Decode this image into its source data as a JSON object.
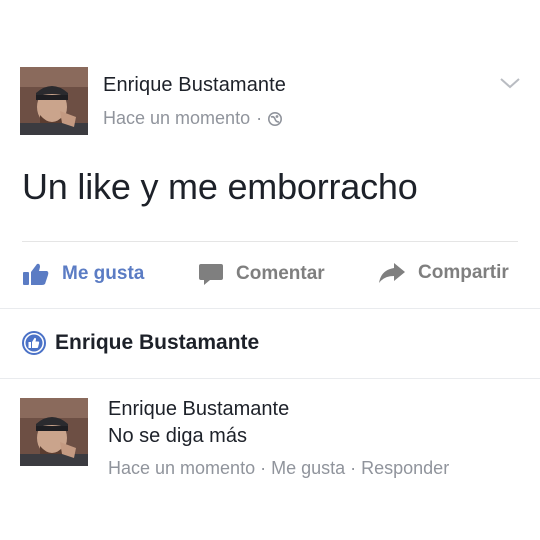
{
  "post": {
    "author": "Enrique Bustamante",
    "timestamp": "Hace un momento",
    "separator": "·",
    "privacy_icon": "globe-icon",
    "menu_icon": "chevron-down-icon",
    "text": "Un like y me emborracho"
  },
  "actions": {
    "like_label": "Me gusta",
    "comment_label": "Comentar",
    "share_label": "Compartir"
  },
  "likes": {
    "icon": "like-badge-icon",
    "name": "Enrique Bustamante"
  },
  "comment": {
    "author": "Enrique Bustamante",
    "text": "No se diga más",
    "timestamp": "Hace un momento",
    "like_label": "Me gusta",
    "reply_label": "Responder",
    "separator": "·"
  },
  "colors": {
    "accent_blue": "#5b7cc4",
    "badge_blue": "#4b72c7",
    "meta_gray": "#90949c",
    "action_gray": "#7f7f7f",
    "text_dark": "#1d2129"
  }
}
